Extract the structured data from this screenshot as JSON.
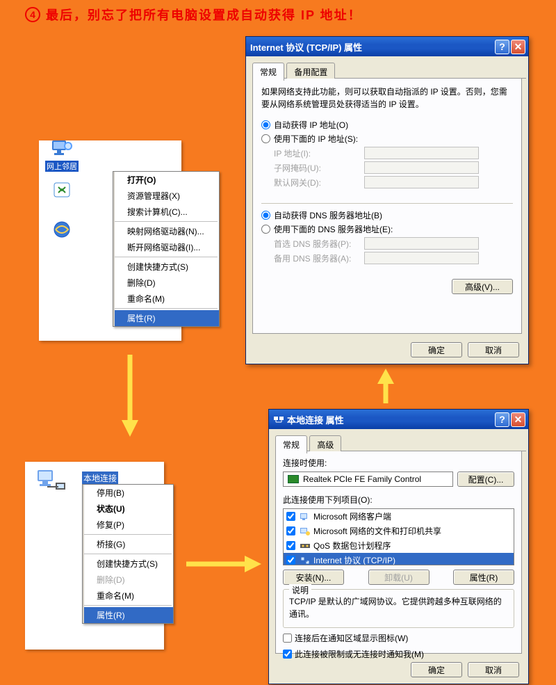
{
  "header": {
    "num": "4",
    "text": "最后，别忘了把所有电脑设置成自动获得 IP 地址！"
  },
  "desktop1": {
    "icons": [
      {
        "name": "network-neighborhood-icon",
        "label": "网上邻居"
      },
      {
        "name": "recycle-bin-icon",
        "label": "回收站"
      },
      {
        "name": "ie-icon",
        "label": "Internet Explorer"
      }
    ],
    "menu": [
      {
        "label": "打开(O)",
        "bold": true
      },
      {
        "label": "资源管理器(X)"
      },
      {
        "label": "搜索计算机(C)..."
      },
      {
        "sep": true
      },
      {
        "label": "映射网络驱动器(N)..."
      },
      {
        "label": "断开网络驱动器(I)..."
      },
      {
        "sep": true
      },
      {
        "label": "创建快捷方式(S)"
      },
      {
        "label": "删除(D)"
      },
      {
        "label": "重命名(M)"
      },
      {
        "sep": true
      },
      {
        "label": "属性(R)",
        "sel": true
      }
    ]
  },
  "desktop2": {
    "lan_label": "本地连接",
    "menu": [
      {
        "label": "停用(B)"
      },
      {
        "label": "状态(U)",
        "bold": true
      },
      {
        "label": "修复(P)"
      },
      {
        "sep": true
      },
      {
        "label": "桥接(G)"
      },
      {
        "sep": true
      },
      {
        "label": "创建快捷方式(S)"
      },
      {
        "label": "删除(D)",
        "dis": true
      },
      {
        "label": "重命名(M)"
      },
      {
        "sep": true
      },
      {
        "label": "属性(R)",
        "sel": true
      }
    ]
  },
  "tcpip": {
    "title": "Internet 协议 (TCP/IP) 属性",
    "tabs": [
      "常规",
      "备用配置"
    ],
    "desc": "如果网络支持此功能，则可以获取自动指派的 IP 设置。否则，您需要从网络系统管理员处获得适当的 IP 设置。",
    "radio_auto_ip": "自动获得 IP 地址(O)",
    "radio_manual_ip": "使用下面的 IP 地址(S):",
    "ip_label": "IP 地址(I):",
    "mask_label": "子网掩码(U):",
    "gw_label": "默认网关(D):",
    "radio_auto_dns": "自动获得 DNS 服务器地址(B)",
    "radio_manual_dns": "使用下面的 DNS 服务器地址(E):",
    "dns1_label": "首选 DNS 服务器(P):",
    "dns2_label": "备用 DNS 服务器(A):",
    "advanced": "高级(V)...",
    "ok": "确定",
    "cancel": "取消"
  },
  "lanprop": {
    "title": "本地连接 属性",
    "tabs": [
      "常规",
      "高级"
    ],
    "connect_using": "连接时使用:",
    "nic": "Realtek PCIe FE Family Control",
    "configure": "配置(C)...",
    "uses_items": "此连接使用下列项目(O):",
    "items": [
      {
        "label": "Microsoft 网络客户端",
        "checked": true,
        "ico": "client"
      },
      {
        "label": "Microsoft 网络的文件和打印机共享",
        "checked": true,
        "ico": "share"
      },
      {
        "label": "QoS 数据包计划程序",
        "checked": true,
        "ico": "qos"
      },
      {
        "label": "Internet 协议 (TCP/IP)",
        "checked": true,
        "ico": "proto",
        "sel": true
      }
    ],
    "install": "安装(N)...",
    "uninstall": "卸载(U)",
    "properties": "属性(R)",
    "desc_heading": "说明",
    "desc": "TCP/IP 是默认的广域网协议。它提供跨越多种互联网络的通讯。",
    "chk_tray": "连接后在通知区域显示图标(W)",
    "chk_limited": "此连接被限制或无连接时通知我(M)",
    "ok": "确定",
    "cancel": "取消"
  }
}
